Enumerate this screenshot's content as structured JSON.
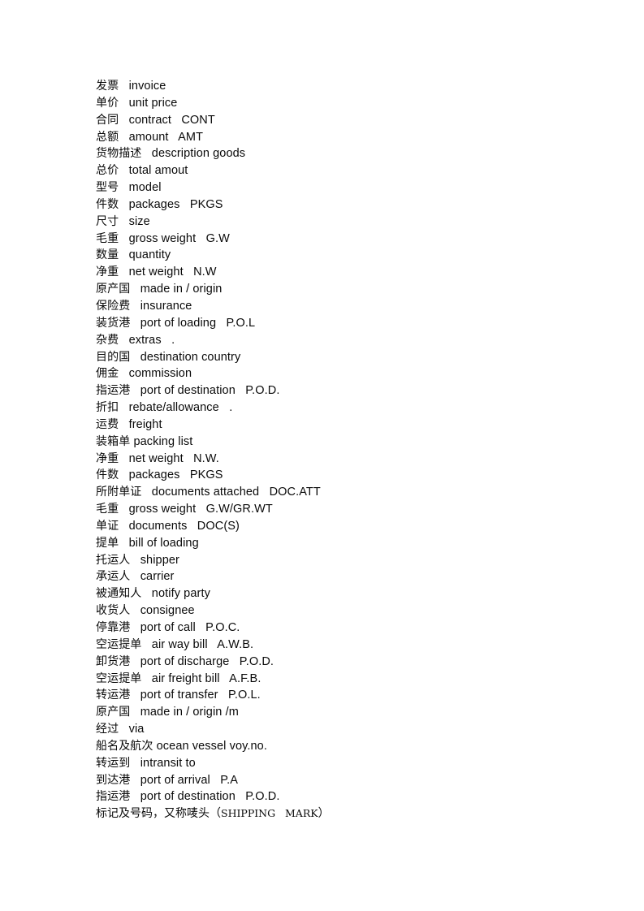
{
  "document": {
    "page_background": "#ffffff",
    "text_color": "#0a0a0a",
    "lines": [
      {
        "zh": "发票",
        "en": "invoice",
        "sep": "   "
      },
      {
        "zh": "单价",
        "en": "unit price",
        "sep": "   "
      },
      {
        "zh": "合同",
        "en": "contract   CONT",
        "sep": "   "
      },
      {
        "zh": "总额",
        "en": "amount   AMT",
        "sep": "   "
      },
      {
        "zh": "货物描述",
        "en": "description goods",
        "sep": "   "
      },
      {
        "zh": "总价",
        "en": "total amout",
        "sep": "   "
      },
      {
        "zh": "型号",
        "en": "model",
        "sep": "   "
      },
      {
        "zh": "件数",
        "en": "packages   PKGS",
        "sep": "   "
      },
      {
        "zh": "尺寸",
        "en": "size",
        "sep": "   "
      },
      {
        "zh": "毛重",
        "en": "gross weight   G.W",
        "sep": "   "
      },
      {
        "zh": "数量",
        "en": "quantity",
        "sep": "   "
      },
      {
        "zh": "净重",
        "en": "net weight   N.W",
        "sep": "   "
      },
      {
        "zh": "原产国",
        "en": "made in / origin",
        "sep": "   "
      },
      {
        "zh": "保险费",
        "en": "insurance",
        "sep": "   "
      },
      {
        "zh": "装货港",
        "en": "port of loading   P.O.L",
        "sep": "   "
      },
      {
        "zh": "杂费",
        "en": "extras   .",
        "sep": "   "
      },
      {
        "zh": "目的国",
        "en": "destination country",
        "sep": "   "
      },
      {
        "zh": "佣金",
        "en": "commission",
        "sep": "   "
      },
      {
        "zh": "指运港",
        "en": "port of destination   P.O.D.",
        "sep": "   "
      },
      {
        "zh": "折扣",
        "en": "rebate/allowance   .",
        "sep": "   "
      },
      {
        "zh": "运费",
        "en": "freight",
        "sep": "   "
      },
      {
        "zh": "装箱单",
        "en": "packing list",
        "sep": " "
      },
      {
        "zh": "净重",
        "en": "net weight   N.W.",
        "sep": "   "
      },
      {
        "zh": "件数",
        "en": "packages   PKGS",
        "sep": "   "
      },
      {
        "zh": "所附单证",
        "en": "documents attached   DOC.ATT",
        "sep": "   "
      },
      {
        "zh": "毛重",
        "en": "gross weight   G.W/GR.WT",
        "sep": "   "
      },
      {
        "zh": "单证",
        "en": "documents   DOC(S)",
        "sep": "   "
      },
      {
        "zh": "提单",
        "en": "bill of loading",
        "sep": "   "
      },
      {
        "zh": "托运人",
        "en": "shipper",
        "sep": "   "
      },
      {
        "zh": "承运人",
        "en": "carrier",
        "sep": "   "
      },
      {
        "zh": "被通知人",
        "en": "notify party",
        "sep": "   "
      },
      {
        "zh": "收货人",
        "en": "consignee",
        "sep": "   "
      },
      {
        "zh": "停靠港",
        "en": "port of call   P.O.C.",
        "sep": "   "
      },
      {
        "zh": "空运提单",
        "en": "air way bill   A.W.B.",
        "sep": "   "
      },
      {
        "zh": "卸货港",
        "en": "port of discharge   P.O.D.",
        "sep": "   "
      },
      {
        "zh": "空运提单",
        "en": "air freight bill   A.F.B.",
        "sep": "   "
      },
      {
        "zh": "转运港",
        "en": "port of transfer   P.O.L.",
        "sep": "   "
      },
      {
        "zh": "原产国",
        "en": "made in / origin /m",
        "sep": "   "
      },
      {
        "zh": "经过",
        "en": "via",
        "sep": "   "
      },
      {
        "zh": "船名及航次",
        "en": "ocean vessel voy.no.",
        "sep": " "
      },
      {
        "zh": "转运到",
        "en": "intransit to",
        "sep": "   "
      },
      {
        "zh": "到达港",
        "en": "port of arrival   P.A",
        "sep": "   "
      },
      {
        "zh": "指运港",
        "en": "port of destination   P.O.D.",
        "sep": "   "
      },
      {
        "zh": "标记及号码，又称唛头（",
        "en": "SHIPPING   MARK",
        "sep": "",
        "tail": "）",
        "serif": true
      }
    ]
  }
}
